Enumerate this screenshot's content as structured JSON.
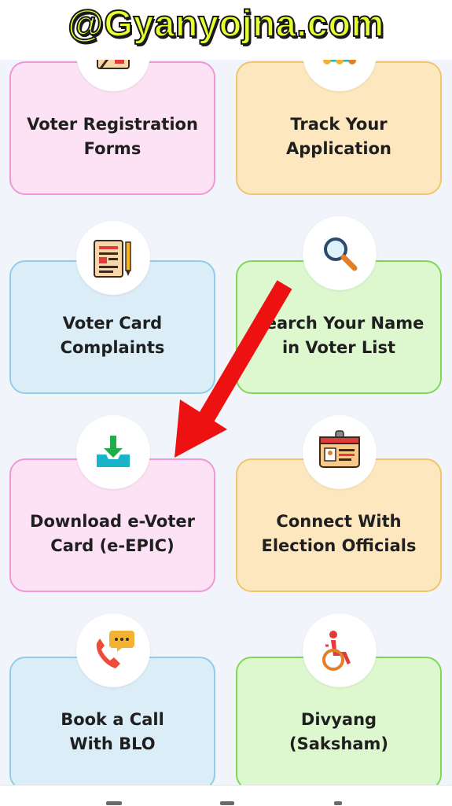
{
  "watermark": {
    "text": "@Gyanyojna.com"
  },
  "cards": [
    {
      "label": "Voter Registration\nForms",
      "icon": "registration-forms-icon",
      "theme": "pink"
    },
    {
      "label": "Track Your\nApplication",
      "icon": "track-application-icon",
      "theme": "orange"
    },
    {
      "label": "Voter Card\nComplaints",
      "icon": "complaint-document-icon",
      "theme": "blue"
    },
    {
      "label": "Search Your Name\nin Voter List",
      "icon": "search-magnifier-icon",
      "theme": "green"
    },
    {
      "label": "Download e-Voter\nCard (e-EPIC)",
      "icon": "download-tray-icon",
      "theme": "pink"
    },
    {
      "label": "Connect With\nElection Officials",
      "icon": "id-badge-icon",
      "theme": "orange"
    },
    {
      "label": "Book a Call\nWith BLO",
      "icon": "phone-call-icon",
      "theme": "blue"
    },
    {
      "label": "Divyang\n(Saksham)",
      "icon": "wheelchair-icon",
      "theme": "green"
    }
  ],
  "colors": {
    "arrow": "#ee1111",
    "pink_card": "#fce2f4",
    "orange_card": "#fde7bf",
    "blue_card": "#dbeef8",
    "green_card": "#ddf7cf",
    "watermark": "#e6ff33"
  }
}
